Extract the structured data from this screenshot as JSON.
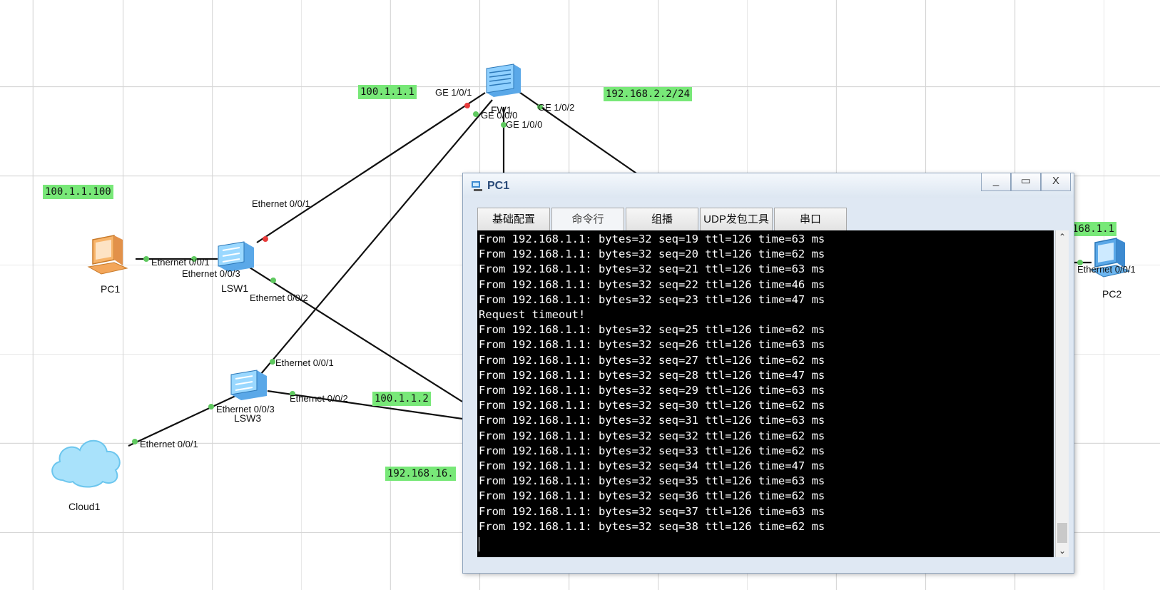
{
  "ip_labels": {
    "fw_ge101": "100.1.1.1",
    "fw_ge102": "192.168.2.2/24",
    "pc1": "100.1.1.100",
    "pc2_partial": "168.1.1",
    "lsw3": "100.1.1.2",
    "bottom": "192.168.16."
  },
  "devices": {
    "fw1": "FW1",
    "lsw1": "LSW1",
    "lsw3": "LSW3",
    "pc1": "PC1",
    "pc2": "PC2",
    "cloud1": "Cloud1"
  },
  "ports": {
    "fw_ge101": "GE 1/0/1",
    "fw_ge000": "GE 0/0/0",
    "fw_ge100": "GE 1/0/0",
    "fw_ge102": "GE 1/0/2",
    "lsw1_e001_up": "Ethernet 0/0/1",
    "lsw1_pc1_side": "Ethernet 0/0/1",
    "lsw1_e003": "Ethernet 0/0/3",
    "lsw1_e002": "Ethernet 0/0/2",
    "lsw3_e001": "Ethernet 0/0/1",
    "lsw3_e002": "Ethernet 0/0/2",
    "lsw3_e003": "Ethernet 0/0/3",
    "cloud_e001": "Ethernet 0/0/1",
    "pc2_e001": "Ethernet 0/0/1"
  },
  "window": {
    "title": "PC1",
    "minimize": "_",
    "maximize": "▭",
    "close": "X",
    "tabs": [
      "基础配置",
      "命令行",
      "组播",
      "UDP发包工具",
      "串口"
    ],
    "active_tab": "命令行",
    "console_lines": [
      "From 192.168.1.1: bytes=32 seq=19 ttl=126 time=63 ms",
      "From 192.168.1.1: bytes=32 seq=20 ttl=126 time=62 ms",
      "From 192.168.1.1: bytes=32 seq=21 ttl=126 time=63 ms",
      "From 192.168.1.1: bytes=32 seq=22 ttl=126 time=46 ms",
      "From 192.168.1.1: bytes=32 seq=23 ttl=126 time=47 ms",
      "Request timeout!",
      "From 192.168.1.1: bytes=32 seq=25 ttl=126 time=62 ms",
      "From 192.168.1.1: bytes=32 seq=26 ttl=126 time=63 ms",
      "From 192.168.1.1: bytes=32 seq=27 ttl=126 time=62 ms",
      "From 192.168.1.1: bytes=32 seq=28 ttl=126 time=47 ms",
      "From 192.168.1.1: bytes=32 seq=29 ttl=126 time=63 ms",
      "From 192.168.1.1: bytes=32 seq=30 ttl=126 time=62 ms",
      "From 192.168.1.1: bytes=32 seq=31 ttl=126 time=63 ms",
      "From 192.168.1.1: bytes=32 seq=32 ttl=126 time=62 ms",
      "From 192.168.1.1: bytes=32 seq=33 ttl=126 time=62 ms",
      "From 192.168.1.1: bytes=32 seq=34 ttl=126 time=47 ms",
      "From 192.168.1.1: bytes=32 seq=35 ttl=126 time=63 ms",
      "From 192.168.1.1: bytes=32 seq=36 ttl=126 time=62 ms",
      "From 192.168.1.1: bytes=32 seq=37 ttl=126 time=63 ms",
      "From 192.168.1.1: bytes=32 seq=38 ttl=126 time=62 ms"
    ]
  },
  "colors": {
    "ip_label_bg": "#78e878",
    "port_up": "#5fc95f",
    "port_down": "#e83b3b",
    "link": "#111111"
  }
}
